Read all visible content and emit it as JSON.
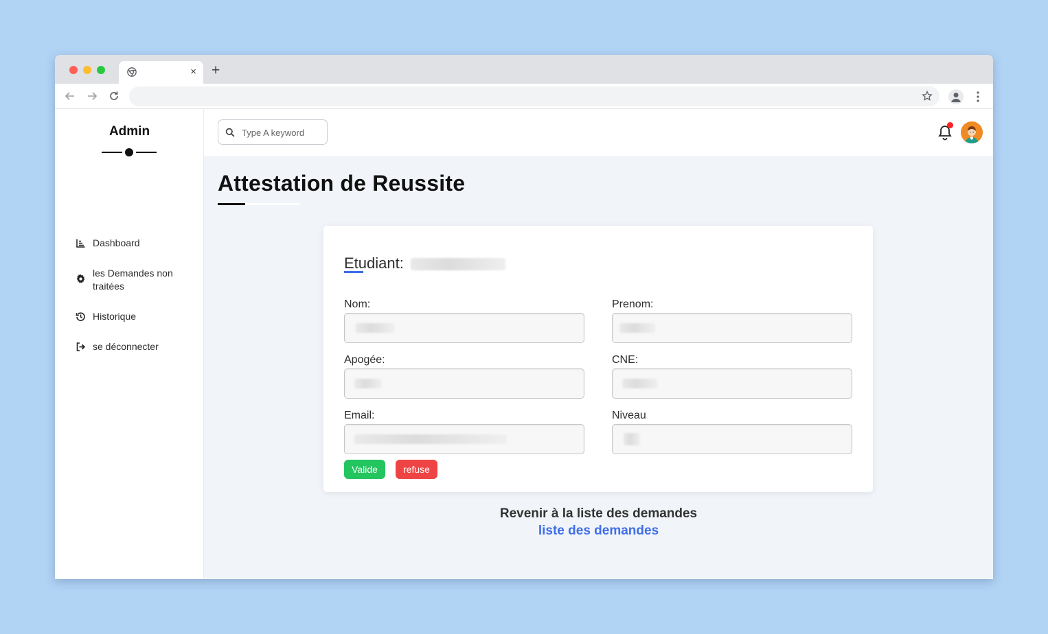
{
  "browser": {
    "new_tab_symbol": "+",
    "close_tab_symbol": "×",
    "icons": [
      "chrome-icon",
      "back-arrow-icon",
      "forward-arrow-icon",
      "reload-icon",
      "star-icon",
      "profile-icon",
      "kebab-menu-icon"
    ]
  },
  "sidebar": {
    "brand": "Admin",
    "items": [
      {
        "label": "Dashboard",
        "icon": "chart-icon"
      },
      {
        "label": "les Demandes non traitées",
        "icon": "gear-icon"
      },
      {
        "label": "Historique",
        "icon": "history-icon"
      },
      {
        "label": "se déconnecter",
        "icon": "logout-icon"
      }
    ]
  },
  "topbar": {
    "search_placeholder": "Type A keyword",
    "has_notification": true
  },
  "page": {
    "title": "Attestation de Reussite"
  },
  "card": {
    "title_prefix": "Etudiant:",
    "fields": {
      "nom_label": "Nom:",
      "prenom_label": "Prenom:",
      "apogee_label": "Apogée:",
      "cne_label": "CNE:",
      "email_label": "Email:",
      "niveau_label": "Niveau"
    },
    "buttons": {
      "valide": "Valide",
      "refuse": "refuse"
    }
  },
  "footer": {
    "back_text": "Revenir à la liste des demandes",
    "back_link": "liste des demandes"
  },
  "colors": {
    "background": "#b1d3f4",
    "accent_blue": "#3f6ee8",
    "valid_green": "#22c55e",
    "refuse_red": "#ef4444",
    "notification_red": "#ff2222"
  }
}
